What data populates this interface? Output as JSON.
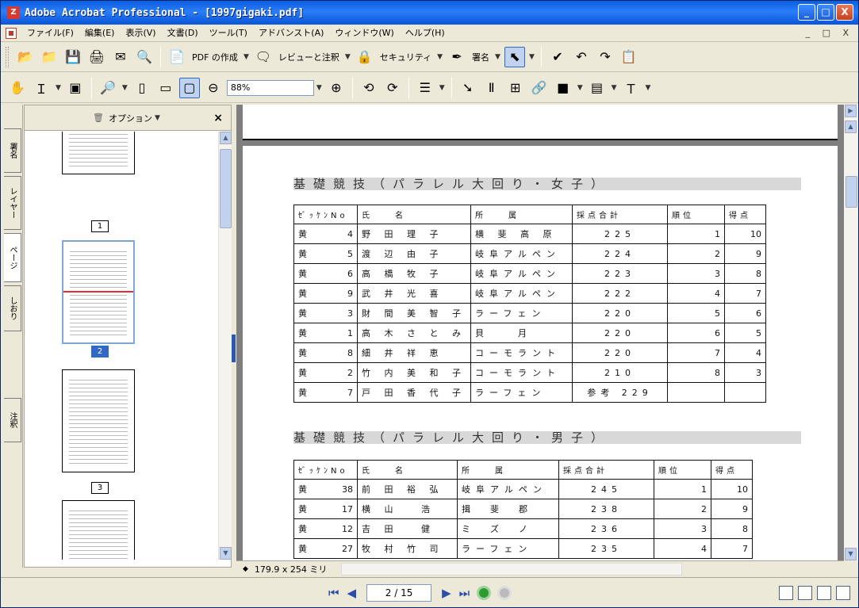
{
  "window": {
    "title": "Adobe Acrobat Professional - [1997gigaki.pdf]",
    "app_icon": "Z"
  },
  "window_buttons": [
    "_",
    "□",
    "X"
  ],
  "menu": [
    "ファイル(F)",
    "編集(E)",
    "表示(V)",
    "文書(D)",
    "ツール(T)",
    "アドバンスト(A)",
    "ウィンドウ(W)",
    "ヘルプ(H)"
  ],
  "mdi_controls": "_ □ X",
  "toolbar1": {
    "create_pdf": "PDF の作成",
    "review": "レビューと注釈",
    "security": "セキュリティ",
    "sign": "署名"
  },
  "toolbar2": {
    "zoom_value": "88%"
  },
  "nav_tabs": [
    "署名",
    "レイヤー",
    "ページ",
    "しおり",
    "注釈"
  ],
  "panel": {
    "options_label": "オプション",
    "close": "×"
  },
  "thumbnails": [
    {
      "label": "1"
    },
    {
      "label": "2"
    },
    {
      "label": "3"
    }
  ],
  "document": {
    "sections": [
      {
        "title": "基礎競技（パラレル大回り・女子）",
        "headers": [
          "ｾﾞｯｹﾝNo",
          "氏　　名",
          "所　　属",
          "採点合計",
          "順位",
          "得点"
        ],
        "rows": [
          [
            "黄",
            "4",
            "野 田 理 子",
            "横 斐 高 原",
            "225",
            "1",
            "10"
          ],
          [
            "黄",
            "5",
            "渡 辺 由 子",
            "岐阜アルペン",
            "224",
            "2",
            "9"
          ],
          [
            "黄",
            "6",
            "高 橋 牧 子",
            "岐阜アルペン",
            "223",
            "3",
            "8"
          ],
          [
            "黄",
            "9",
            "武 井 光 喜",
            "岐阜アルペン",
            "222",
            "4",
            "7"
          ],
          [
            "黄",
            "3",
            "財 間 美 智 子",
            "ラーフェン",
            "220",
            "5",
            "6"
          ],
          [
            "黄",
            "1",
            "高 木 さ と み",
            "貝　　月",
            "220",
            "6",
            "5"
          ],
          [
            "黄",
            "8",
            "細 井 祥 恵",
            "コーモラント",
            "220",
            "7",
            "4"
          ],
          [
            "黄",
            "2",
            "竹 内 美 和 子",
            "コーモラント",
            "210",
            "8",
            "3"
          ],
          [
            "黄",
            "7",
            "戸 田 香 代 子",
            "ラーフェン",
            "参考 229",
            "",
            ""
          ]
        ]
      },
      {
        "title": "基礎競技（パラレル大回り・男子）",
        "headers": [
          "ｾﾞｯｹﾝNo",
          "氏　　名",
          "所　　属",
          "採点合計",
          "順位",
          "得点"
        ],
        "rows": [
          [
            "黄",
            "38",
            "前 田 裕 弘",
            "岐阜アルペン",
            "245",
            "1",
            "10"
          ],
          [
            "黄",
            "17",
            "横 山　 浩",
            "揖　斐　郡",
            "238",
            "2",
            "9"
          ],
          [
            "黄",
            "12",
            "吉 田　 健",
            "ミ　ズ　ノ",
            "236",
            "3",
            "8"
          ],
          [
            "黄",
            "27",
            "牧 村 竹 司",
            "ラーフェン",
            "235",
            "4",
            "7"
          ]
        ]
      }
    ]
  },
  "page_size": "179.9 x 254 ミリ",
  "status": {
    "page": "2 / 15"
  }
}
